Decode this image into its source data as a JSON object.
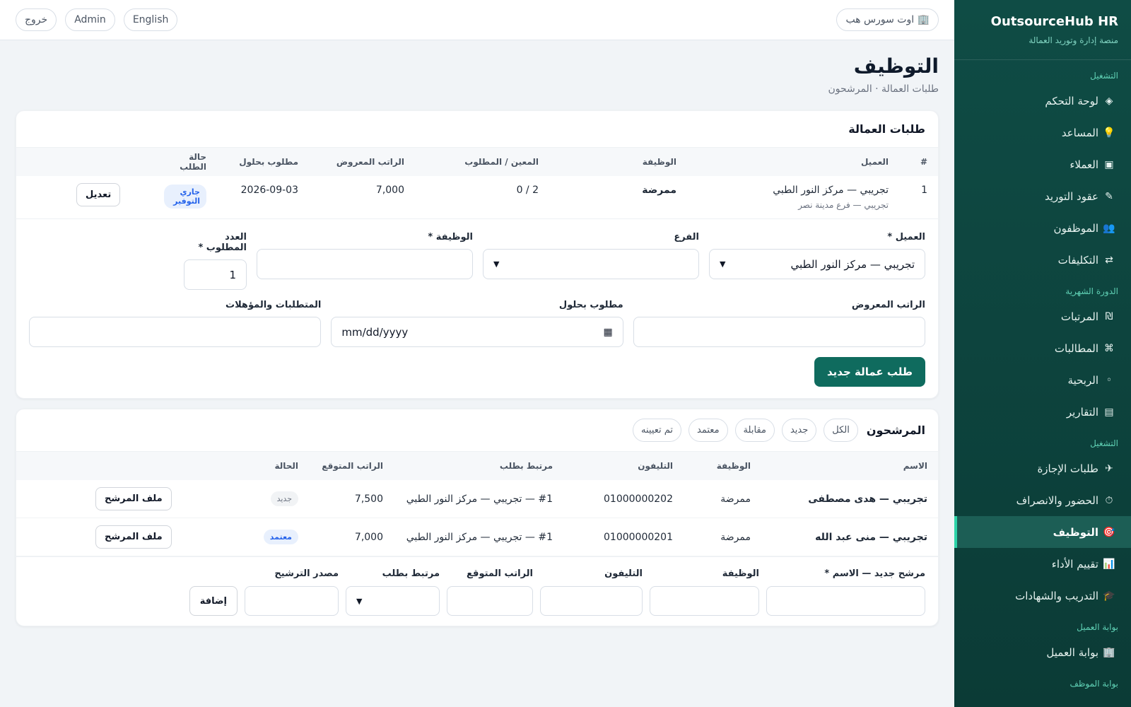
{
  "sidebar": {
    "brand_title": "OutsourceHub HR",
    "brand_sub": "منصة إدارة وتوريد العمالة",
    "sections": {
      "operations": "التشغيل",
      "monthly": "الدورة الشهرية",
      "operations2": "التشغيل",
      "client_portal": "بوابة العميل",
      "employee_portal": "بوابة الموظف"
    },
    "items": [
      {
        "icon": "◈",
        "label": "لوحة التحكم"
      },
      {
        "icon": "💡",
        "label": "المساعد"
      },
      {
        "icon": "▣",
        "label": "العملاء"
      },
      {
        "icon": "✎",
        "label": "عقود التوريد"
      },
      {
        "icon": "👥",
        "label": "الموظفون"
      },
      {
        "icon": "⇄",
        "label": "التكليفات"
      },
      {
        "icon": "₪",
        "label": "المرتبات"
      },
      {
        "icon": "⌘",
        "label": "المطالبات"
      },
      {
        "icon": "◦",
        "label": "الربحية"
      },
      {
        "icon": "▤",
        "label": "التقارير"
      },
      {
        "icon": "✈",
        "label": "طلبات الإجازة"
      },
      {
        "icon": "⏱",
        "label": "الحضور والانصراف"
      },
      {
        "icon": "🎯",
        "label": "التوظيف"
      },
      {
        "icon": "📊",
        "label": "تقييم الأداء"
      },
      {
        "icon": "🎓",
        "label": "التدريب والشهادات"
      },
      {
        "icon": "🏢",
        "label": "بوابة العميل"
      }
    ]
  },
  "topbar": {
    "org_label": "🏢 اوت سورس هب",
    "language": "English",
    "user": "Admin",
    "logout": "خروج"
  },
  "page": {
    "title": "التوظيف",
    "subtitle": "طلبات العمالة · المرشحون"
  },
  "requests": {
    "title": "طلبات العمالة",
    "headers": [
      "#",
      "العميل",
      "الوظيفة",
      "المعين / المطلوب",
      "الراتب المعروض",
      "مطلوب بحلول",
      "حالة الطلب"
    ],
    "row": {
      "num": "1",
      "client": "تجريبي — مركز النور الطبي",
      "branch": "تجريبي — فرع مدينة نصر",
      "job": "ممرضة",
      "filled": "0 / 2",
      "salary": "7,000",
      "due": "2026-09-03",
      "status": "جاري التوفير",
      "edit": "تعديل"
    },
    "form": {
      "client_label": "العميل *",
      "client_value": "تجريبي — مركز النور الطبي",
      "branch_label": "الفرع",
      "job_label": "الوظيفة *",
      "count_label": "العدد المطلوب *",
      "count_value": "1",
      "salary_label": "الراتب المعروض",
      "due_label": "مطلوب بحلول",
      "due_placeholder": "mm/dd/yyyy",
      "req_label": "المتطلبات والمؤهلات",
      "submit": "طلب عمالة جديد"
    }
  },
  "candidates": {
    "title": "المرشحون",
    "filters": [
      "الكل",
      "جديد",
      "مقابلة",
      "معتمد",
      "تم تعيينه"
    ],
    "headers": [
      "الاسم",
      "الوظيفة",
      "التليفون",
      "مرتبط بطلب",
      "الراتب المتوقع",
      "الحالة"
    ],
    "rows": [
      {
        "name": "تجريبي — هدى مصطفى",
        "job": "ممرضة",
        "phone": "01000000202",
        "linked": "#1 — تجريبي — مركز النور الطبي",
        "salary": "7,500",
        "status": "جديد",
        "action": "ملف المرشح"
      },
      {
        "name": "تجريبي — منى عبد الله",
        "job": "ممرضة",
        "phone": "01000000201",
        "linked": "#1 — تجريبي — مركز النور الطبي",
        "salary": "7,000",
        "status": "معتمد",
        "action": "ملف المرشح"
      }
    ],
    "form": {
      "name_label": "مرشح جديد — الاسم *",
      "job_label": "الوظيفة",
      "phone_label": "التليفون",
      "salary_label": "الراتب المتوقع",
      "linked_label": "مرتبط بطلب",
      "source_label": "مصدر الترشيح",
      "add": "إضافة"
    }
  }
}
